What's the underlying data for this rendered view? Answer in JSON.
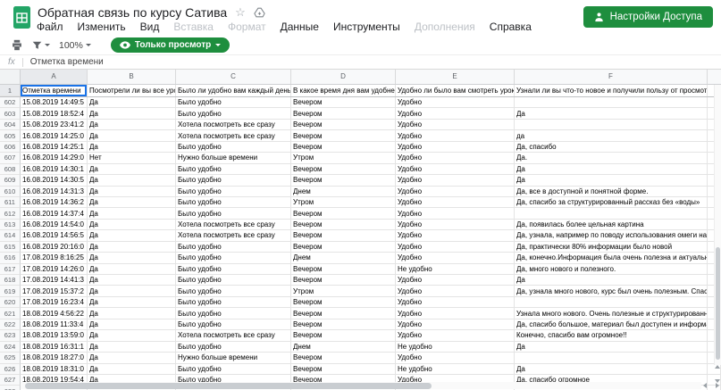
{
  "header": {
    "title": "Обратная связь по курсу Сатива",
    "star_icon_glyph": "☆",
    "menu": [
      {
        "label": "Файл",
        "enabled": true
      },
      {
        "label": "Изменить",
        "enabled": true
      },
      {
        "label": "Вид",
        "enabled": true
      },
      {
        "label": "Вставка",
        "enabled": false
      },
      {
        "label": "Формат",
        "enabled": false
      },
      {
        "label": "Данные",
        "enabled": true
      },
      {
        "label": "Инструменты",
        "enabled": true
      },
      {
        "label": "Дополнения",
        "enabled": false
      },
      {
        "label": "Справка",
        "enabled": true
      }
    ],
    "share_button_label": "Настройки Доступа"
  },
  "toolbar": {
    "zoom": "100%",
    "view_mode_label": "Только просмотр"
  },
  "formula_bar": {
    "fx": "fx",
    "value": "Отметка времени"
  },
  "colors": {
    "accent_green": "#1e8e3e",
    "logo_green": "#23a566",
    "selection_blue": "#1a73e8"
  },
  "sheet": {
    "selected_cell": "A1",
    "column_letters": [
      "A",
      "B",
      "C",
      "D",
      "E",
      "F"
    ],
    "header_row": {
      "n": "1",
      "headers": [
        "Отметка времени",
        "Посмотрели ли вы все уроки?",
        "Было ли удобно вам каждый день с",
        "В какое время дня вам удобнее",
        "Удобно ли было вам смотреть уроки",
        "Узнали ли вы что-то новое и получили пользу от просмотра кур"
      ]
    },
    "rows": [
      {
        "n": 602,
        "cells": [
          "15.08.2019 14:49:5",
          "Да",
          "Было удобно",
          "Вечером",
          "Удобно",
          ""
        ]
      },
      {
        "n": 603,
        "cells": [
          "15.08.2019 18:52:4",
          "Да",
          "Было удобно",
          "Вечером",
          "Удобно",
          "Да"
        ]
      },
      {
        "n": 604,
        "cells": [
          "15.08.2019 23:41:2",
          "Да",
          "Хотела посмотреть все сразу",
          "Вечером",
          "Удобно",
          ""
        ]
      },
      {
        "n": 605,
        "cells": [
          "16.08.2019 14:25:0",
          "Да",
          "Хотела посмотреть все сразу",
          "Вечером",
          "Удобно",
          "да"
        ]
      },
      {
        "n": 606,
        "cells": [
          "16.08.2019 14:25:1",
          "Да",
          "Было удобно",
          "Вечером",
          "Удобно",
          "Да, спасибо"
        ]
      },
      {
        "n": 607,
        "cells": [
          "16.08.2019 14:29:0",
          "Нет",
          "Нужно больше времени",
          "Утром",
          "Удобно",
          "Да."
        ]
      },
      {
        "n": 608,
        "cells": [
          "16.08.2019 14:30:1",
          "Да",
          "Было удобно",
          "Вечером",
          "Удобно",
          "Да"
        ]
      },
      {
        "n": 609,
        "cells": [
          "16.08.2019 14:30:5",
          "Да",
          "Было удобно",
          "Вечером",
          "Удобно",
          "Да"
        ]
      },
      {
        "n": 610,
        "cells": [
          "16.08.2019 14:31:3",
          "Да",
          "Было удобно",
          "Днем",
          "Удобно",
          "Да, все в доступной и понятной форме."
        ]
      },
      {
        "n": 611,
        "cells": [
          "16.08.2019 14:36:2",
          "Да",
          "Было удобно",
          "Утром",
          "Удобно",
          "Да, спасибо за структурированный рассказ без «воды»"
        ]
      },
      {
        "n": 612,
        "cells": [
          "16.08.2019 14:37:4",
          "Да",
          "Было удобно",
          "Вечером",
          "Удобно",
          ""
        ]
      },
      {
        "n": 613,
        "cells": [
          "16.08.2019 14:54:0",
          "Да",
          "Хотела посмотреть все сразу",
          "Вечером",
          "Удобно",
          "Да, появилась более цельная картина"
        ]
      },
      {
        "n": 614,
        "cells": [
          "16.08.2019 14:56:5",
          "Да",
          "Хотела посмотреть все сразу",
          "Вечером",
          "Удобно",
          "Да, узнала, например по поводу  использования омеги на лиц"
        ]
      },
      {
        "n": 615,
        "cells": [
          "16.08.2019 20:16:0",
          "Да",
          "Было удобно",
          "Вечером",
          "Удобно",
          "Да, практически 80% информации было новой"
        ]
      },
      {
        "n": 616,
        "cells": [
          "17.08.2019 8:16:25",
          "Да",
          "Было удобно",
          "Днем",
          "Удобно",
          "Да, конечно.Информация была очень полезна и актуальна."
        ]
      },
      {
        "n": 617,
        "cells": [
          "17.08.2019 14:26:0",
          "Да",
          "Было удобно",
          "Вечером",
          "Не удобно",
          "Да, много нового и полезного."
        ]
      },
      {
        "n": 618,
        "cells": [
          "17.08.2019 14:41:3",
          "Да",
          "Было удобно",
          "Вечером",
          "Удобно",
          "Да"
        ]
      },
      {
        "n": 619,
        "cells": [
          "17.08.2019 15:37:2",
          "Да",
          "Было удобно",
          "Утром",
          "Удобно",
          "Да, узнала много нового, курс был очень полезным. Спасибо о"
        ]
      },
      {
        "n": 620,
        "cells": [
          "17.08.2019 16:23:4",
          "Да",
          "Было удобно",
          "Вечером",
          "Удобно",
          ""
        ]
      },
      {
        "n": 621,
        "cells": [
          "18.08.2019 4:56:22",
          "Да",
          "Было удобно",
          "Вечером",
          "Удобно",
          "Узнала много нового. Очень полезные и структурированные по"
        ]
      },
      {
        "n": 622,
        "cells": [
          "18.08.2019 11:33:4",
          "Да",
          "Было удобно",
          "Вечером",
          "Удобно",
          "Да, спасибо большое, материал был доступен и информативе"
        ]
      },
      {
        "n": 623,
        "cells": [
          "18.08.2019 13:59:0",
          "Да",
          "Хотела посмотреть все сразу",
          "Вечером",
          "Удобно",
          "Конечно, спасибо вам огромное!!"
        ]
      },
      {
        "n": 624,
        "cells": [
          "18.08.2019 16:31:1",
          "Да",
          "Было удобно",
          "Днем",
          "Не удобно",
          "Да"
        ]
      },
      {
        "n": 625,
        "cells": [
          "18.08.2019 18:27:0",
          "Да",
          "Нужно больше времени",
          "Вечером",
          "Удобно",
          ""
        ]
      },
      {
        "n": 626,
        "cells": [
          "18.08.2019 18:31:0",
          "Да",
          "Было удобно",
          "Вечером",
          "Не удобно",
          "Да"
        ]
      },
      {
        "n": 627,
        "cells": [
          "18.08.2019 19:54:4",
          "Да",
          "Было удобно",
          "Вечером",
          "Удобно",
          "Да, спасибо огромное"
        ]
      },
      {
        "n": 628,
        "cells": [
          "",
          "",
          "",
          "",
          "",
          ""
        ]
      }
    ]
  }
}
